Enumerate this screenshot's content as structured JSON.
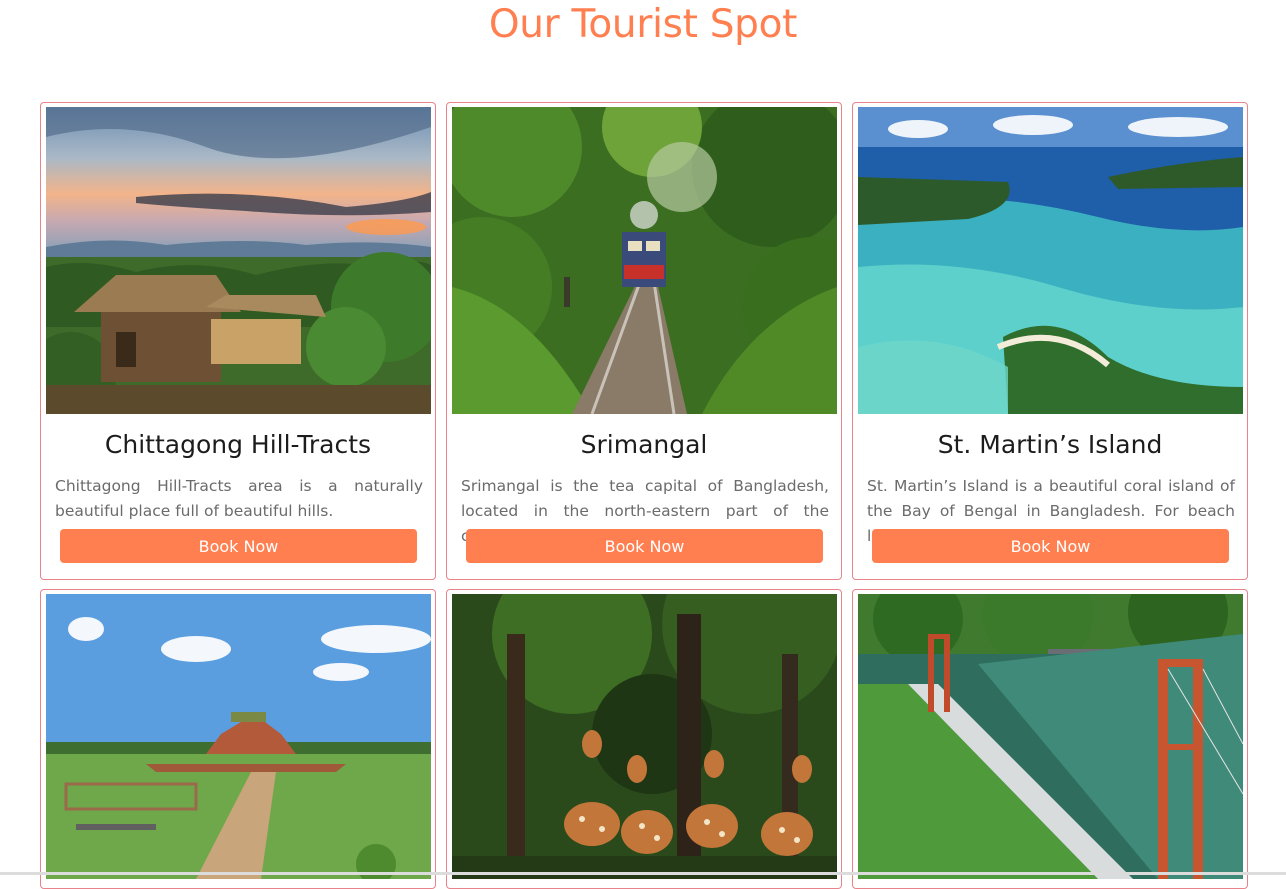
{
  "page": {
    "title": "Our Tourist Spot"
  },
  "theme": {
    "accent": "#ff7f50",
    "card_border": "#e8838b",
    "title_text": "#1c1c1c",
    "desc_text": "#6b6b6b"
  },
  "spots": [
    {
      "name": "Chittagong Hill-Tracts",
      "description": "Chittagong Hill-Tracts area is a naturally beautiful place full of beautiful hills.",
      "button": "Book Now",
      "image_icon": "hill-hut-photo"
    },
    {
      "name": "Srimangal",
      "description": "Srimangal is the tea capital of Bangladesh, located in the north-eastern part of the country.",
      "button": "Book Now",
      "image_icon": "forest-train-photo"
    },
    {
      "name": "St. Martin’s Island",
      "description": "St. Martin’s Island is a beautiful coral island of the Bay of Bengal in Bangladesh. For beach lovers.",
      "button": "Book Now",
      "image_icon": "island-lagoon-photo"
    },
    {
      "image_icon": "paharpur-ruins-photo"
    },
    {
      "image_icon": "spotted-deer-photo"
    },
    {
      "image_icon": "hanging-bridge-lake-photo"
    }
  ]
}
